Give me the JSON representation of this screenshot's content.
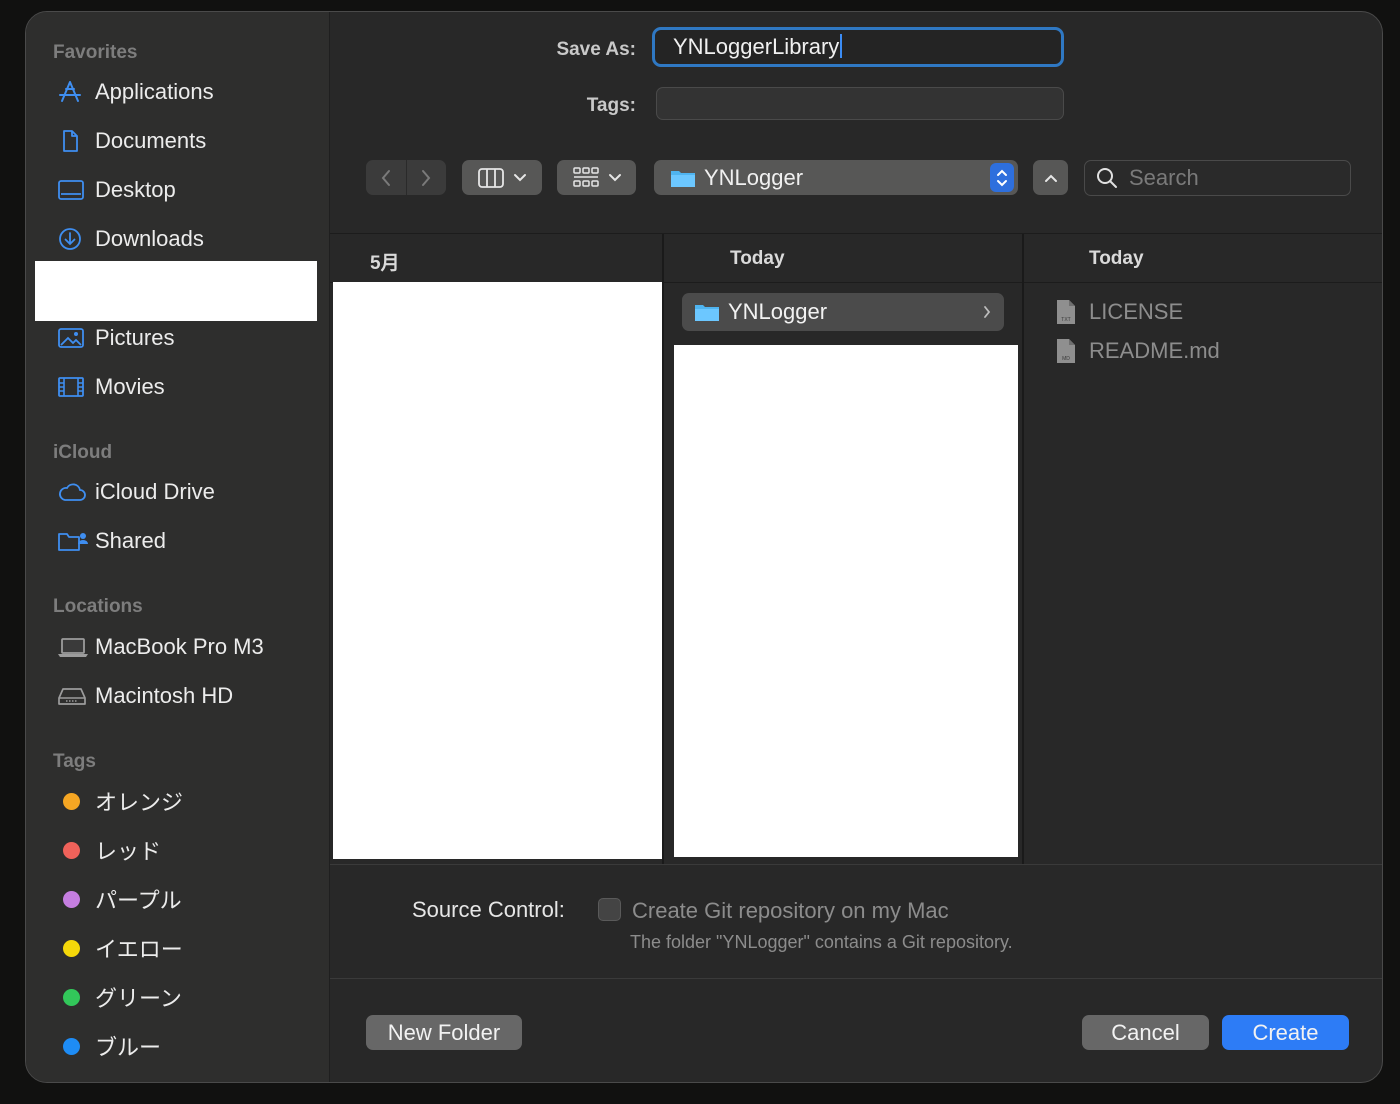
{
  "sidebar": {
    "sections": {
      "favorites": "Favorites",
      "icloud": "iCloud",
      "locations": "Locations",
      "tags": "Tags"
    },
    "favorites": [
      {
        "label": "Applications",
        "icon": "applications-icon"
      },
      {
        "label": "Documents",
        "icon": "document-icon"
      },
      {
        "label": "Desktop",
        "icon": "desktop-icon"
      },
      {
        "label": "Downloads",
        "icon": "downloads-icon"
      },
      {
        "label": "",
        "icon": ""
      },
      {
        "label": "Pictures",
        "icon": "pictures-icon"
      },
      {
        "label": "Movies",
        "icon": "movies-icon"
      }
    ],
    "icloud": [
      {
        "label": "iCloud Drive",
        "icon": "cloud-icon"
      },
      {
        "label": "Shared",
        "icon": "shared-folder-icon"
      }
    ],
    "locations": [
      {
        "label": "MacBook Pro M3",
        "icon": "laptop-icon"
      },
      {
        "label": "Macintosh HD",
        "icon": "hard-drive-icon"
      }
    ],
    "tags": [
      {
        "label": "オレンジ",
        "color": "#f5a623"
      },
      {
        "label": "レッド",
        "color": "#f0625a"
      },
      {
        "label": "パープル",
        "color": "#c57ee0"
      },
      {
        "label": "イエロー",
        "color": "#f5d80a"
      },
      {
        "label": "グリーン",
        "color": "#32c75a"
      },
      {
        "label": "ブルー",
        "color": "#1e8cf5"
      }
    ]
  },
  "form": {
    "save_as_label": "Save As:",
    "save_as_value": "YNLoggerLibrary",
    "tags_label": "Tags:",
    "tags_value": ""
  },
  "toolbar": {
    "back_icon": "chevron-left-icon",
    "forward_icon": "chevron-right-icon",
    "view_mode_icon": "columns-view-icon",
    "group_icon": "grid-group-icon",
    "location": "YNLogger",
    "search_placeholder": "Search"
  },
  "columns": [
    {
      "header": "5月",
      "items": []
    },
    {
      "header": "Today",
      "items": [
        {
          "name": "YNLogger",
          "type": "folder",
          "selected": true
        }
      ]
    },
    {
      "header": "Today",
      "items": [
        {
          "name": "LICENSE",
          "type": "file",
          "badge": "TXT"
        },
        {
          "name": "README.md",
          "type": "file",
          "badge": "MD"
        }
      ]
    }
  ],
  "source_control": {
    "label": "Source Control:",
    "checkbox_label": "Create Git repository on my Mac",
    "checked": false,
    "note": "The folder \"YNLogger\" contains a Git repository."
  },
  "buttons": {
    "new_folder": "New Folder",
    "cancel": "Cancel",
    "create": "Create"
  },
  "colors": {
    "accent": "#2d7cf6",
    "focus_ring": "#2f78c3",
    "sidebar_icon": "#3f8ef0"
  }
}
